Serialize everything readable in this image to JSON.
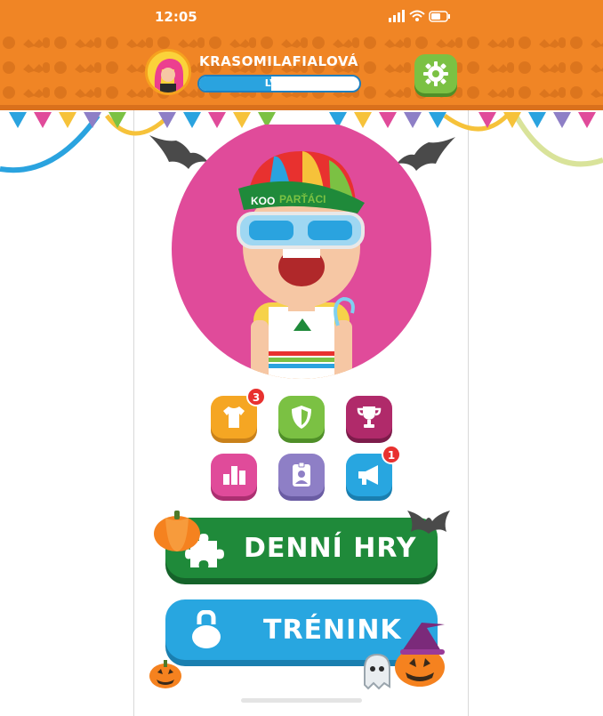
{
  "status_bar": {
    "time": "12:05"
  },
  "profile": {
    "username": "KRASOMILAFIALOVÁ",
    "level_label": "LVL 6",
    "level_progress": 0.45
  },
  "menu_icons": [
    {
      "name": "wardrobe",
      "badge": "3"
    },
    {
      "name": "shield",
      "badge": ""
    },
    {
      "name": "trophy",
      "badge": ""
    },
    {
      "name": "leaderboard",
      "badge": ""
    },
    {
      "name": "id-card",
      "badge": ""
    },
    {
      "name": "megaphone",
      "badge": "1"
    }
  ],
  "character": {
    "cap_text_left": "KOO",
    "cap_text_right": "PARŤÁCI"
  },
  "buttons": {
    "daily_games": "DENNÍ HRY",
    "training": "TRÉNINK"
  },
  "colors": {
    "header": "#f08525",
    "settings": "#7bc143",
    "daily_games": "#1f8a3a",
    "training": "#28a6e0",
    "wardrobe": "#f5a623",
    "shield": "#7bc143",
    "trophy": "#b02a6a",
    "leaderboard": "#e04b9a",
    "id_card": "#8e7fc6",
    "megaphone": "#28a6e0"
  }
}
